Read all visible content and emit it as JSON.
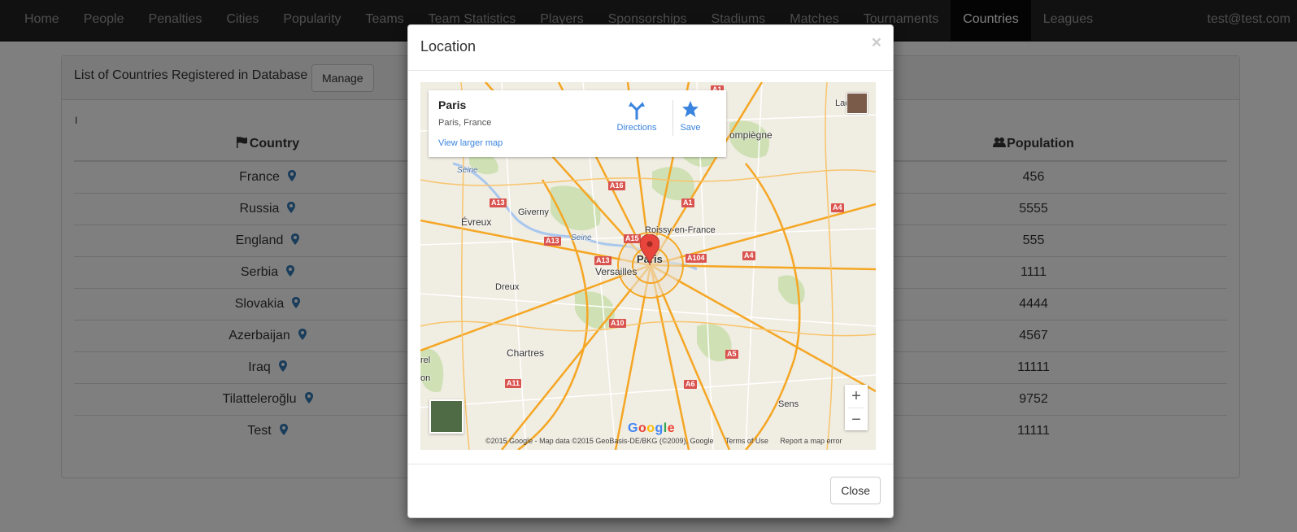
{
  "navbar": {
    "items": [
      "Home",
      "People",
      "Penalties",
      "Cities",
      "Popularity",
      "Teams",
      "Team Statistics",
      "Players",
      "Sponsorships",
      "Stadiums",
      "Matches",
      "Tournaments",
      "Countries",
      "Leagues"
    ],
    "active": "Countries",
    "user": "test@test.com"
  },
  "panel": {
    "title": "List of Countries Registered in Database",
    "manage_label": "Manage",
    "cursor_mark": "I",
    "columns": {
      "country": "Country",
      "population": "Population"
    },
    "rows": [
      {
        "country": "France",
        "population": "456"
      },
      {
        "country": "Russia",
        "population": "5555"
      },
      {
        "country": "England",
        "population": "555"
      },
      {
        "country": "Serbia",
        "population": "1111"
      },
      {
        "country": "Slovakia",
        "population": "4444"
      },
      {
        "country": "Azerbaijan",
        "population": "4567"
      },
      {
        "country": "Iraq",
        "population": "11111"
      },
      {
        "country": "Tilatteleroğlu",
        "population": "9752"
      },
      {
        "country": "Test",
        "population": "11111"
      }
    ]
  },
  "modal": {
    "title": "Location",
    "close_x": "×",
    "close_label": "Close"
  },
  "map": {
    "place_name": "Paris",
    "place_address": "Paris, France",
    "view_larger": "View larger map",
    "directions_label": "Directions",
    "save_label": "Save",
    "zoom_in": "+",
    "zoom_out": "−",
    "attribution": "©2015 Google - Map data ©2015 GeoBasis-DE/BKG (©2009), Google",
    "terms": "Terms of Use",
    "report": "Report a map error",
    "labels": {
      "paris": "Paris",
      "versailles": "Versailles",
      "evreux": "Évreux",
      "giverny": "Giverny",
      "roissy": "Roissy-en-France",
      "compiegne": "ompiègne",
      "dreux": "Dreux",
      "chartres": "Chartres",
      "sens": "Sens",
      "lao": "Lao",
      "rel": "rel",
      "on": "on",
      "seine1": "Seine",
      "seine2": "Seine"
    },
    "shields": [
      "A1",
      "A16",
      "A13",
      "A1",
      "A4",
      "A13",
      "A15",
      "A104",
      "A4",
      "A13",
      "A10",
      "A5",
      "A11",
      "A6"
    ],
    "colors": {
      "land": "#f0ede3",
      "park": "#cfe1b4",
      "road": "#f5a623",
      "minor_road": "#ffffff",
      "marker": "#e8453c"
    }
  },
  "icons": {
    "pin": "map-marker-icon",
    "flag": "flag-icon",
    "users": "users-icon"
  },
  "colors": {
    "navbar_bg": "#222222",
    "active_bg": "#080808",
    "link_blue": "#3a84df",
    "pin_blue": "#337ab7"
  }
}
